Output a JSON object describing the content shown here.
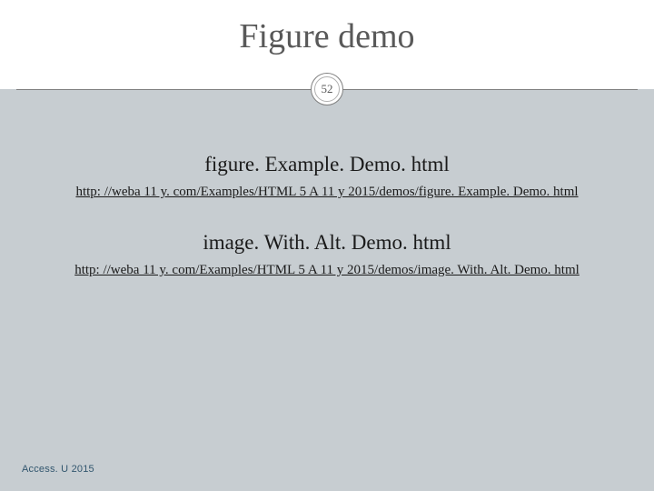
{
  "title": "Figure demo",
  "page_number": "52",
  "demos": [
    {
      "heading": "figure. Example. Demo. html",
      "url": "http: //weba 11 y. com/Examples/HTML 5 A 11 y 2015/demos/figure. Example. Demo. html"
    },
    {
      "heading": "image. With. Alt. Demo. html",
      "url": "http: //weba 11 y. com/Examples/HTML 5 A 11 y 2015/demos/image. With. Alt. Demo. html"
    }
  ],
  "footer": "Access. U 2015"
}
